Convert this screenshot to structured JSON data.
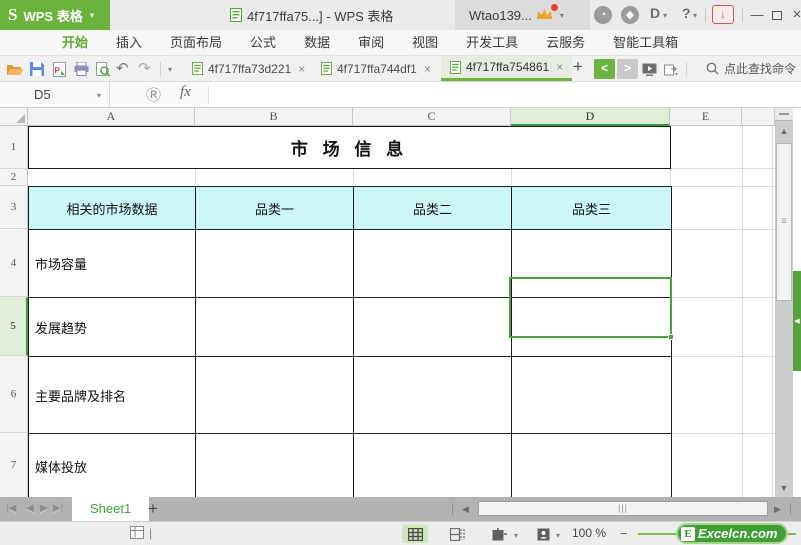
{
  "title_bar": {
    "logo_glyph": "S",
    "app_name": "WPS 表格",
    "document_title": "4f717ffa75...] - WPS 表格",
    "account_name": "Wtao139...",
    "download_center_label": "D",
    "help_label": "?",
    "minimize_glyph": "—",
    "close_glyph": "×"
  },
  "menu_bar": {
    "items": [
      "开始",
      "插入",
      "页面布局",
      "公式",
      "数据",
      "审阅",
      "视图",
      "开发工具",
      "云服务",
      "智能工具箱"
    ],
    "active_item": "开始"
  },
  "tab_bar": {
    "document_tabs": [
      {
        "label": "4f717ffa73d221",
        "close": "×"
      },
      {
        "label": "4f717ffa744df1",
        "close": "×"
      },
      {
        "label": "4f717ffa754861",
        "close": "×"
      }
    ],
    "active_tab": "4f717ffa754861",
    "new_tab_glyph": "+",
    "prev_glyph": "<",
    "next_glyph": ">",
    "search_hint": "点此查找命令"
  },
  "formula_bar": {
    "name_box": "D5",
    "search_glyph": "Ⓡ",
    "fx_label": "fx",
    "formula_value": ""
  },
  "sheet": {
    "column_headers": [
      "A",
      "B",
      "C",
      "D",
      "E"
    ],
    "row_headers": [
      "1",
      "2",
      "3",
      "4",
      "5",
      "6",
      "7"
    ],
    "selected_cell": "D5",
    "selected_column": "D",
    "selected_row": "5",
    "title_cell_text": "市 场 信 息",
    "table_headers": [
      "相关的市场数据",
      "品类一",
      "品类二",
      "品类三"
    ],
    "row_labels": [
      "市场容量",
      "发展趋势",
      "主要品牌及排名",
      "媒体投放"
    ],
    "header_fill_color": "#ccf6f8",
    "selection_color": "#4aa23c",
    "accent_green": "#3e9b3b"
  },
  "sheet_tab_bar": {
    "sheet_name": "Sheet1",
    "add_sheet_glyph": "+"
  },
  "status_bar": {
    "zoom_level": "100 %",
    "watermark_letter": "E",
    "watermark_text": "Excelcn.com"
  },
  "icons": {
    "caret_down": "▾",
    "undo": "↶",
    "redo": "↷",
    "up_arrow": "▲",
    "down_arrow": "▼",
    "left_arrow": "◀",
    "right_arrow": "▶",
    "first_sheet": "|◀",
    "prev_sheet": "◀",
    "next_sheet": "▶",
    "last_sheet": "▶|",
    "thumb_grip_v": "≡",
    "thumb_grip_h": "|||",
    "sidebar_collapse": "◀",
    "download_arrow": "↓",
    "minus": "−",
    "cursor_bar": "|"
  }
}
